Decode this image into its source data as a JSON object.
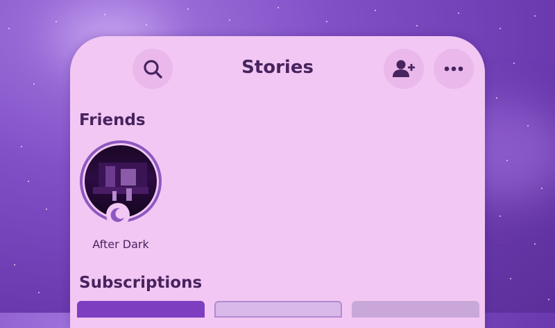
{
  "header": {
    "title": "Stories",
    "icons": {
      "search": "search-icon",
      "add_friend": "add-friend-icon",
      "more": "more-icon"
    }
  },
  "friends": {
    "section_label": "Friends",
    "stories": [
      {
        "name": "After Dark",
        "badge_icon": "moon-icon"
      }
    ]
  },
  "subscriptions": {
    "section_label": "Subscriptions",
    "tiles": [
      {
        "color": "#7d3fc0"
      },
      {
        "color": "#d9b9e9"
      },
      {
        "color": "#c9a8d9"
      }
    ]
  },
  "colors": {
    "accent": "#8b59c0",
    "card": "#f3c7f3",
    "text": "#47245f",
    "background": "#8150c7"
  }
}
